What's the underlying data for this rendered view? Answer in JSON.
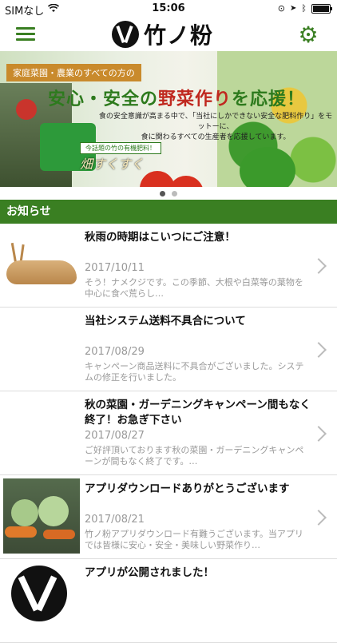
{
  "status_bar": {
    "carrier": "SIMなし",
    "time": "15:06",
    "battery_level": 0.9
  },
  "nav": {
    "menu_icon": "hamburger-icon",
    "logo_text": "竹ノ粉",
    "settings_icon": "gear-icon",
    "accent_color": "#3a7f22"
  },
  "banner": {
    "badge_label": "家庭菜園・農業のすべての方の",
    "headline_green1": "安心・安全の",
    "headline_red": "野菜作り",
    "headline_green2": "を応援！",
    "sub_text_1": "食の安全意識が高まる中で、「当社にしかできない安全な肥料作り」をモットーに、",
    "sub_text_2": "食に関わるすべての生産者を応援しています。",
    "tag_text": "今話題の竹の有機肥料！",
    "product_text": "畑すくすく",
    "page_count": 2,
    "current_page": 1
  },
  "section_title": "お知らせ",
  "news": [
    {
      "title": "秋雨の時期はこいつにご注意！",
      "date": "2017/10/11",
      "excerpt": "そう！ナメクジです。この季節、大根や白菜等の葉物を中心に食べ荒らし…",
      "thumbnail": "slug-image"
    },
    {
      "title": "当社システム送料不具合について",
      "date": "2017/08/29",
      "excerpt": "キャンペーン商品送料に不具合がございました。システムの修正を行いました。",
      "thumbnail": ""
    },
    {
      "title": "秋の菜園・ガーデニングキャンペーン間もなく終了！お急ぎ下さい",
      "date": "2017/08/27",
      "excerpt": "ご好評頂いております秋の菜園・ガーデニングキャンペーンが間もなく終了です。…",
      "thumbnail": ""
    },
    {
      "title": "アプリダウンロードありがとうございます",
      "date": "2017/08/21",
      "excerpt": "竹ノ粉アプリダウンロード有難うございます。当アプリでは皆様に安心・安全・美味しい野菜作り…",
      "thumbnail": "cabbage-image"
    },
    {
      "title": "アプリが公開されました！",
      "date": "",
      "excerpt": "",
      "thumbnail": "logo-image"
    }
  ]
}
